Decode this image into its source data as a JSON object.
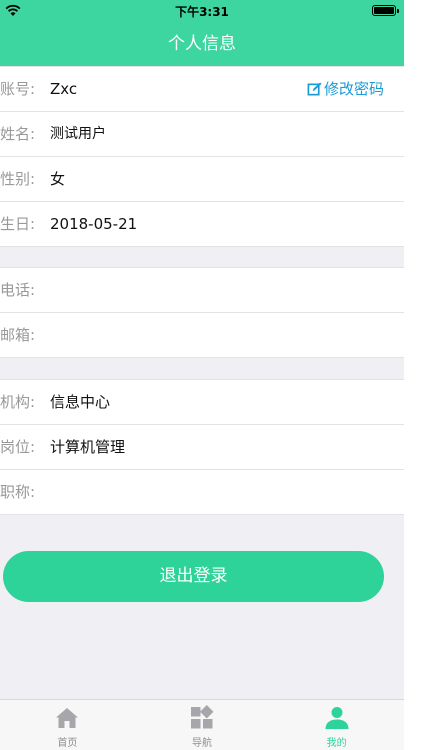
{
  "status_bar": {
    "time": "下午3:31"
  },
  "nav": {
    "title": "个人信息"
  },
  "profile": {
    "account": {
      "label": "账号:",
      "value": "Zxc",
      "action": "修改密码"
    },
    "name": {
      "label": "姓名:",
      "value": "测试用户"
    },
    "gender": {
      "label": "性别:",
      "value": "女"
    },
    "birthday": {
      "label": "生日:",
      "value": "2018-05-21"
    },
    "phone": {
      "label": "电话:",
      "value": ""
    },
    "email": {
      "label": "邮箱:",
      "value": ""
    },
    "org": {
      "label": "机构:",
      "value": "信息中心"
    },
    "post": {
      "label": "岗位:",
      "value": "计算机管理"
    },
    "title": {
      "label": "职称:",
      "value": ""
    }
  },
  "logout_label": "退出登录",
  "tabs": [
    {
      "label": "首页",
      "icon": "home-icon"
    },
    {
      "label": "导航",
      "icon": "grid-icon"
    },
    {
      "label": "我的",
      "icon": "person-icon"
    }
  ],
  "colors": {
    "accent": "#2ed39a",
    "header": "#3dd6a0",
    "link": "#1a9bd7"
  }
}
